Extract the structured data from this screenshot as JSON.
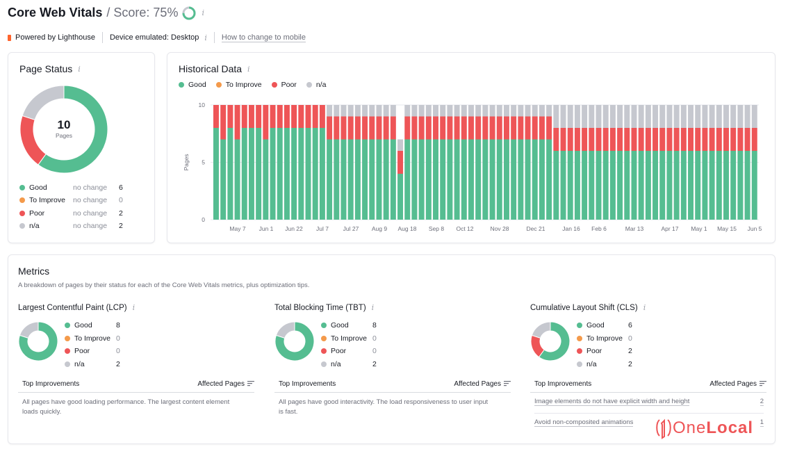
{
  "header": {
    "title": "Core Web Vitals",
    "score_label": "/ Score: 75%",
    "score_value": 0.75,
    "powered_by": "Powered by Lighthouse",
    "device": "Device emulated: Desktop",
    "change_link": "How to change to mobile"
  },
  "colors": {
    "good": "#55bd91",
    "to_improve": "#f49a4b",
    "poor": "#ee5557",
    "na": "#c6c8cf"
  },
  "page_status": {
    "title": "Page Status",
    "total": "10",
    "total_label": "Pages",
    "rows": [
      {
        "label": "Good",
        "change": "no change",
        "value": "6",
        "key": "good"
      },
      {
        "label": "To Improve",
        "change": "no change",
        "value": "0",
        "key": "to_improve"
      },
      {
        "label": "Poor",
        "change": "no change",
        "value": "2",
        "key": "poor"
      },
      {
        "label": "n/a",
        "change": "no change",
        "value": "2",
        "key": "na"
      }
    ]
  },
  "historical": {
    "title": "Historical Data",
    "legend": [
      "Good",
      "To Improve",
      "Poor",
      "n/a"
    ]
  },
  "chart_data": {
    "type": "bar",
    "stacked": true,
    "title": "Historical Data",
    "ylabel": "Pages",
    "xlabel": "",
    "ylim": [
      0,
      10
    ],
    "yticks": [
      0,
      5,
      10
    ],
    "xtick_labels": [
      "May 7",
      "Jun 1",
      "Jun 22",
      "Jul 7",
      "Jul 27",
      "Aug 9",
      "Aug 18",
      "Sep 8",
      "Oct 12",
      "Nov 28",
      "Dec 21",
      "Jan 16",
      "Feb 6",
      "Mar 13",
      "Apr 17",
      "May 1",
      "May 15",
      "Jun 5"
    ],
    "legend": "top-left",
    "segments": [
      {
        "count": 1,
        "good": 8,
        "to_improve": 0,
        "poor": 2,
        "na": 0
      },
      {
        "count": 1,
        "good": 7,
        "to_improve": 0,
        "poor": 3,
        "na": 0
      },
      {
        "count": 1,
        "good": 8,
        "to_improve": 0,
        "poor": 2,
        "na": 0
      },
      {
        "count": 1,
        "good": 7,
        "to_improve": 0,
        "poor": 3,
        "na": 0
      },
      {
        "count": 3,
        "good": 8,
        "to_improve": 0,
        "poor": 2,
        "na": 0
      },
      {
        "count": 1,
        "good": 7,
        "to_improve": 0,
        "poor": 3,
        "na": 0
      },
      {
        "count": 8,
        "good": 8,
        "to_improve": 0,
        "poor": 2,
        "na": 0
      },
      {
        "count": 10,
        "good": 7,
        "to_improve": 0,
        "poor": 2,
        "na": 1
      },
      {
        "count": 1,
        "good": 4,
        "to_improve": 0,
        "poor": 2,
        "na": 1
      },
      {
        "count": 21,
        "good": 7,
        "to_improve": 0,
        "poor": 2,
        "na": 1
      },
      {
        "count": 29,
        "good": 6,
        "to_improve": 0,
        "poor": 2,
        "na": 2
      }
    ]
  },
  "metrics": {
    "title": "Metrics",
    "description": "A breakdown of pages by their status for each of the Core Web Vitals metrics, plus optimization tips.",
    "header_left": "Top Improvements",
    "header_right": "Affected Pages",
    "items": [
      {
        "title": "Largest Contentful Paint (LCP)",
        "values": {
          "good": 8,
          "to_improve": 0,
          "poor": 0,
          "na": 2
        },
        "legend": [
          {
            "label": "Good",
            "value": "8"
          },
          {
            "label": "To Improve",
            "value": "0"
          },
          {
            "label": "Poor",
            "value": "0"
          },
          {
            "label": "n/a",
            "value": "2"
          }
        ],
        "note": "All pages have good loading performance. The largest content element loads quickly.",
        "improvements": []
      },
      {
        "title": "Total Blocking Time (TBT)",
        "values": {
          "good": 8,
          "to_improve": 0,
          "poor": 0,
          "na": 2
        },
        "legend": [
          {
            "label": "Good",
            "value": "8"
          },
          {
            "label": "To Improve",
            "value": "0"
          },
          {
            "label": "Poor",
            "value": "0"
          },
          {
            "label": "n/a",
            "value": "2"
          }
        ],
        "note": "All pages have good interactivity. The load responsiveness to user input is fast.",
        "improvements": []
      },
      {
        "title": "Cumulative Layout Shift (CLS)",
        "values": {
          "good": 6,
          "to_improve": 0,
          "poor": 2,
          "na": 2
        },
        "legend": [
          {
            "label": "Good",
            "value": "6"
          },
          {
            "label": "To Improve",
            "value": "0"
          },
          {
            "label": "Poor",
            "value": "2"
          },
          {
            "label": "n/a",
            "value": "2"
          }
        ],
        "note": "",
        "improvements": [
          {
            "label": "Image elements do not have explicit width and height",
            "value": "2"
          },
          {
            "label": "Avoid non-composited animations",
            "value": "1"
          }
        ]
      }
    ]
  },
  "watermark": {
    "one": "One",
    "local": "Local"
  }
}
